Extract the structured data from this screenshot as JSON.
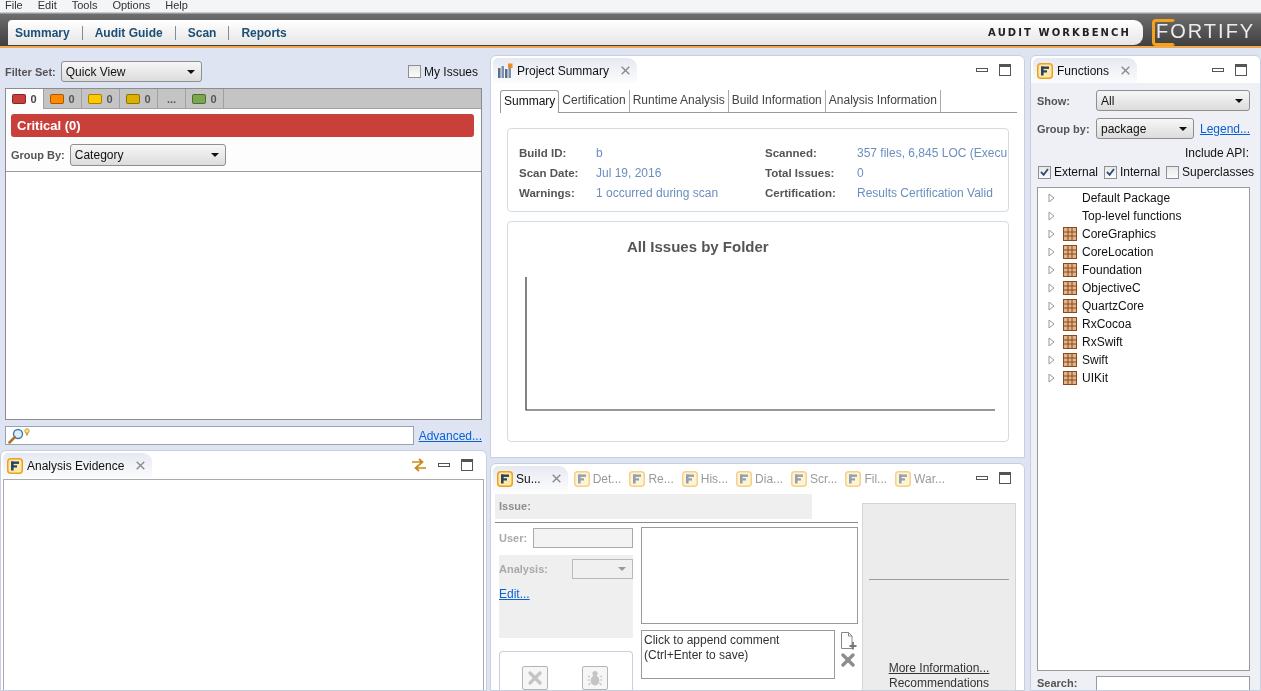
{
  "menu_bar": [
    "File",
    "Edit",
    "Tools",
    "Options",
    "Help"
  ],
  "header": {
    "nav_links": [
      "Summary",
      "Audit Guide",
      "Scan",
      "Reports"
    ],
    "product_name": "AUDIT WORKBENCH",
    "logo": "FORTIFY"
  },
  "filter_panel": {
    "filter_set_label": "Filter Set:",
    "filter_set": "Quick View",
    "my_issues": {
      "label": "My Issues",
      "checked": false
    },
    "severity_tabs": [
      {
        "kind": "severity",
        "count": "0",
        "color": "#c9403a",
        "selected": true
      },
      {
        "kind": "severity",
        "count": "0",
        "color": "#ff8a00",
        "selected": false
      },
      {
        "kind": "severity",
        "count": "0",
        "color": "#ffc800",
        "selected": false
      },
      {
        "kind": "severity",
        "count": "0",
        "color": "#dcb000",
        "selected": false
      },
      {
        "kind": "more",
        "label": "...",
        "selected": false
      },
      {
        "kind": "severity",
        "count": "0",
        "color": "#7aa84e",
        "selected": false
      }
    ],
    "group_title": "Critical (0)",
    "group_by_label": "Group By:",
    "group_by": "Category",
    "advanced_link": "Advanced..."
  },
  "analysis_evidence": {
    "title": "Analysis Evidence"
  },
  "project_summary": {
    "title": "Project Summary",
    "tabs": [
      {
        "label": "Summary",
        "selected": true
      },
      {
        "label": "Certification",
        "selected": false
      },
      {
        "label": "Runtime Analysis",
        "selected": false
      },
      {
        "label": "Build Information",
        "selected": false
      },
      {
        "label": "Analysis Information",
        "selected": false
      }
    ],
    "details_left": [
      {
        "label": "Build ID:",
        "value": "b"
      },
      {
        "label": "Scan Date:",
        "value": "Jul 19, 2016"
      },
      {
        "label": "Warnings:",
        "value": "1 occurred during scan"
      }
    ],
    "details_right": [
      {
        "label": "Scanned:",
        "value": "357 files, 6,845 LOC (Execu"
      },
      {
        "label": "Total Issues:",
        "value": "0"
      },
      {
        "label": "Certification:",
        "value": "Results Certification Valid"
      }
    ],
    "chart": {
      "title": "All Issues by Folder"
    }
  },
  "issue_panel": {
    "tabs": [
      {
        "label": "Su...",
        "selected": true
      },
      {
        "label": "Det...",
        "selected": false
      },
      {
        "label": "Re...",
        "selected": false
      },
      {
        "label": "His...",
        "selected": false
      },
      {
        "label": "Dia...",
        "selected": false
      },
      {
        "label": "Scr...",
        "selected": false
      },
      {
        "label": "Fil...",
        "selected": false
      },
      {
        "label": "War...",
        "selected": false
      }
    ],
    "issue_label": "Issue:",
    "user": {
      "label": "User:",
      "disabled": true
    },
    "analysis": {
      "label": "Analysis:",
      "disabled": true
    },
    "edit_link": "Edit...",
    "comment_placeholder": "Click to append comment\n(Ctrl+Enter to save)",
    "action_buttons": [
      {
        "kind": "suppress",
        "disabled": true
      },
      {
        "kind": "bug",
        "disabled": true
      }
    ],
    "more_info_link": "More Information...",
    "recommendations": "Recommendations"
  },
  "functions": {
    "title": "Functions",
    "show_label": "Show:",
    "show": "All",
    "group_by_label": "Group by:",
    "group_by": "package",
    "legend_link": "Legend...",
    "include_api_label": "Include API:",
    "include_api": [
      {
        "label": "External",
        "checked": true
      },
      {
        "label": "Internal",
        "checked": true
      },
      {
        "label": "Superclasses",
        "checked": false
      }
    ],
    "tree": [
      {
        "kind": "plain",
        "label": "Default Package",
        "expanded": false
      },
      {
        "kind": "plain",
        "label": "Top-level functions",
        "expanded": false
      },
      {
        "kind": "package",
        "label": "CoreGraphics",
        "expanded": false
      },
      {
        "kind": "package",
        "label": "CoreLocation",
        "expanded": false
      },
      {
        "kind": "package",
        "label": "Foundation",
        "expanded": false
      },
      {
        "kind": "package",
        "label": "ObjectiveC",
        "expanded": false
      },
      {
        "kind": "package",
        "label": "QuartzCore",
        "expanded": false
      },
      {
        "kind": "package",
        "label": "RxCocoa",
        "expanded": false
      },
      {
        "kind": "package",
        "label": "RxSwift",
        "expanded": false
      },
      {
        "kind": "package",
        "label": "Swift",
        "expanded": false
      },
      {
        "kind": "package",
        "label": "UIKit",
        "expanded": false
      }
    ],
    "search_label": "Search:"
  }
}
